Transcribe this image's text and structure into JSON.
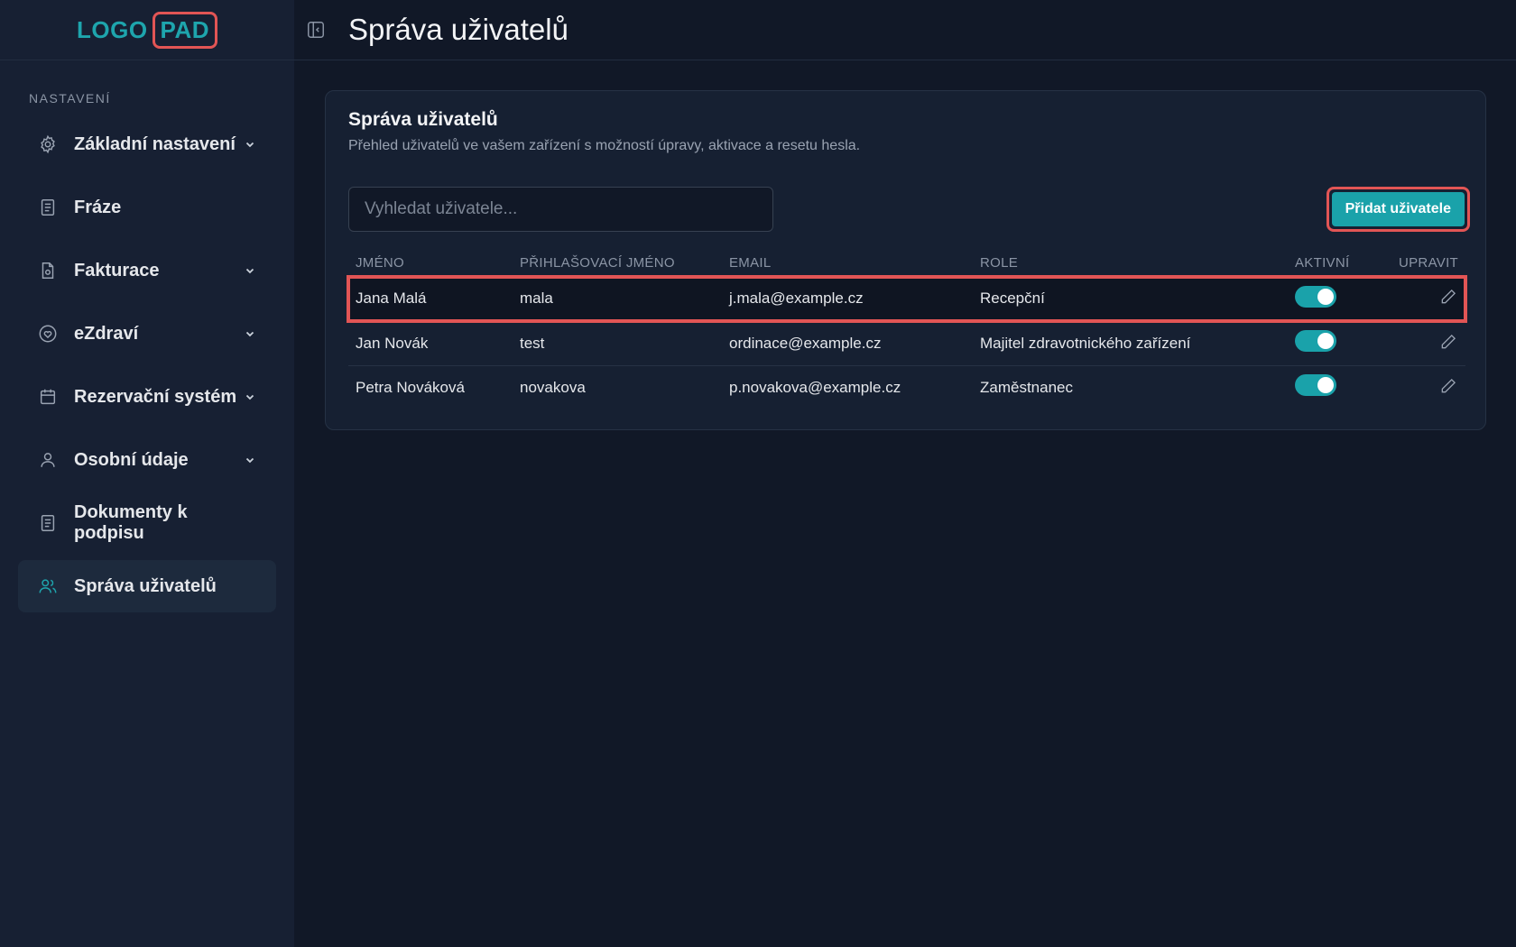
{
  "logo": {
    "part1": "LOGO",
    "part2": "PAD"
  },
  "sidebar": {
    "section_label": "NASTAVENÍ",
    "items": [
      {
        "label": "Základní nastavení",
        "icon": "gear-icon",
        "has_chevron": true
      },
      {
        "label": "Fráze",
        "icon": "document-icon",
        "has_chevron": false
      },
      {
        "label": "Fakturace",
        "icon": "invoice-icon",
        "has_chevron": true
      },
      {
        "label": "eZdraví",
        "icon": "heart-icon",
        "has_chevron": true
      },
      {
        "label": "Rezervační systém",
        "icon": "calendar-icon",
        "has_chevron": true
      },
      {
        "label": "Osobní údaje",
        "icon": "user-icon",
        "has_chevron": true
      },
      {
        "label": "Dokumenty k podpisu",
        "icon": "document-icon",
        "has_chevron": false
      },
      {
        "label": "Správa uživatelů",
        "icon": "users-icon",
        "has_chevron": false,
        "active": true
      }
    ]
  },
  "header": {
    "title": "Správa uživatelů"
  },
  "card": {
    "title": "Správa uživatelů",
    "subtitle": "Přehled uživatelů ve vašem zařízení s možností úpravy, aktivace a resetu hesla.",
    "search_placeholder": "Vyhledat uživatele...",
    "add_button": "Přidat uživatele"
  },
  "table": {
    "headers": {
      "name": "JMÉNO",
      "login": "PŘIHLAŠOVACÍ JMÉNO",
      "email": "EMAIL",
      "role": "ROLE",
      "active": "AKTIVNÍ",
      "edit": "UPRAVIT"
    },
    "rows": [
      {
        "name": "Jana Malá",
        "login": "mala",
        "email": "j.mala@example.cz",
        "role": "Recepční",
        "active": true
      },
      {
        "name": "Jan Novák",
        "login": "test",
        "email": "ordinace@example.cz",
        "role": "Majitel zdravotnického zařízení",
        "active": true
      },
      {
        "name": "Petra Nováková",
        "login": "novakova",
        "email": "p.novakova@example.cz",
        "role": "Zaměstnanec",
        "active": true
      }
    ]
  },
  "colors": {
    "accent": "#1aa2aa",
    "highlight": "#e25555",
    "background": "#111827",
    "sidebar": "#172033"
  }
}
